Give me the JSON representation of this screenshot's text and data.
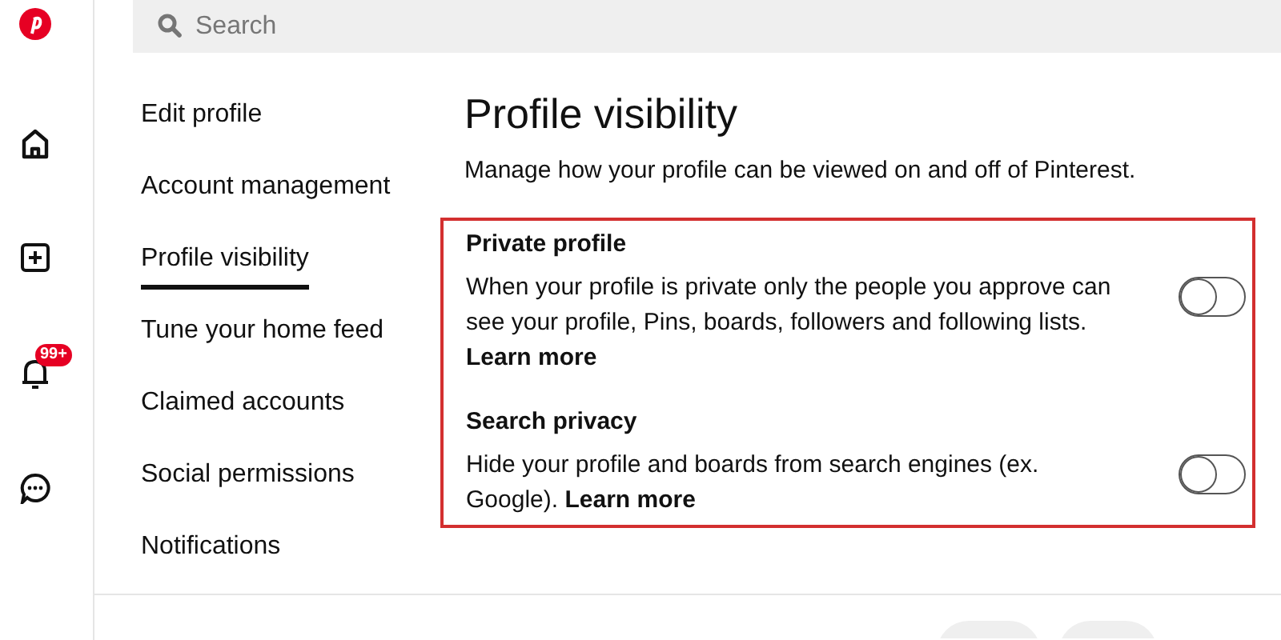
{
  "search": {
    "placeholder": "Search"
  },
  "notifications_badge": "99+",
  "settings_nav": [
    {
      "label": "Edit profile",
      "selected": false
    },
    {
      "label": "Account management",
      "selected": false
    },
    {
      "label": "Profile visibility",
      "selected": true
    },
    {
      "label": "Tune your home feed",
      "selected": false
    },
    {
      "label": "Claimed accounts",
      "selected": false
    },
    {
      "label": "Social permissions",
      "selected": false
    },
    {
      "label": "Notifications",
      "selected": false
    }
  ],
  "page": {
    "title": "Profile visibility",
    "subtitle": "Manage how your profile can be viewed on and off of Pinterest."
  },
  "settings": [
    {
      "title": "Private profile",
      "description": "When your profile is private only the people you approve can see your profile, Pins, boards, followers and following lists.",
      "link": "Learn more",
      "on": false
    },
    {
      "title": "Search privacy",
      "description": "Hide your profile and boards from search engines (ex. Google).",
      "link": "Learn more",
      "on": false
    }
  ]
}
